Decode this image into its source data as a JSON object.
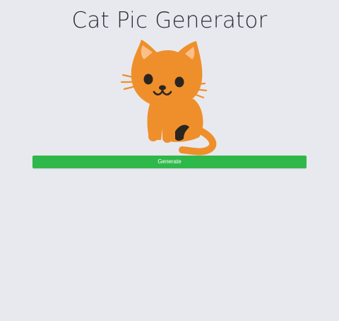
{
  "header": {
    "title": "Cat Pic Generator"
  },
  "main": {
    "image": {
      "icon": "cat-emoji",
      "colors": {
        "fur": "#ef8f2b",
        "ear_inner": "#fbc08a",
        "features": "#2b2520",
        "whiskers": "#ef8f2b"
      }
    },
    "generate_button": {
      "label": "Generate",
      "color": "#2fb84a"
    }
  },
  "colors": {
    "background": "#e8e9ef",
    "title_text": "#2b2f3a"
  }
}
